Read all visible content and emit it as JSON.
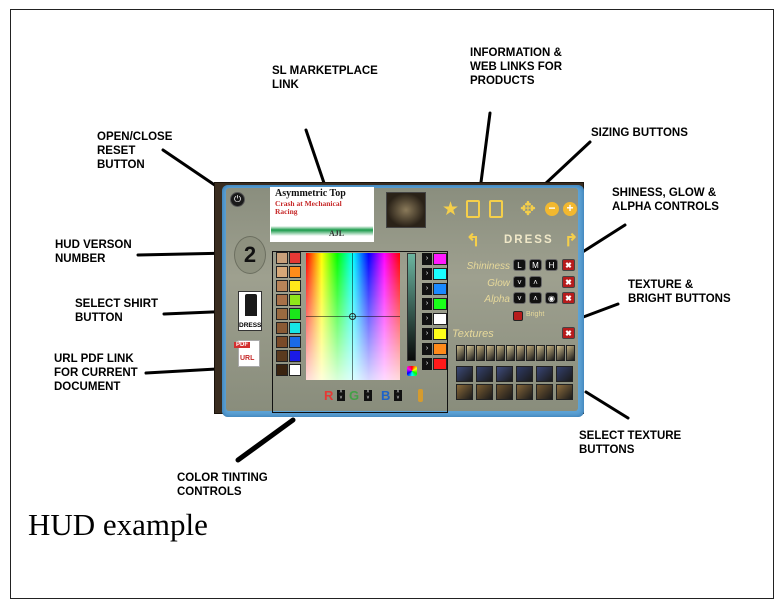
{
  "caption": "HUD example",
  "callouts": {
    "marketplace": "SL MARKETPLACE\nLINK",
    "info": "INFORMATION &\nWEB LINKS FOR\nPRODUCTS",
    "sizing": "SIZING BUTTONS",
    "open_close": "OPEN/CLOSE\nRESET\nBUTTON",
    "shininess": "SHINESS, GLOW &\nALPHA CONTROLS",
    "version": "HUD VERSON\nNUMBER",
    "texture_bright": "TEXTURE &\nBRIGHT BUTTONS",
    "shirt": "SELECT SHIRT\nBUTTON",
    "pdf": "URL PDF LINK\nFOR CURRENT\nDOCUMENT",
    "select_texture": "SELECT TEXTURE\nBUTTONS",
    "color": "COLOR TINTING\nCONTROLS"
  },
  "hud": {
    "power_glyph": "⏻",
    "version_number": "2",
    "banner": {
      "title": "Asymmetric Top",
      "subtitle": "Crash at Mechanical Racing",
      "brand": "AJL"
    },
    "shirt_label": "DRESS",
    "pdf_tag": "PDF",
    "pdf_url": "URL",
    "top_icons": {
      "star": "★",
      "move": "✥",
      "minus": "−",
      "plus": "+"
    },
    "nav": {
      "title": "DRESS",
      "prev_arrow": "↰",
      "next_arrow": "↱"
    },
    "controls": {
      "shininess_label": "Shininess",
      "glow_label": "Glow",
      "alpha_label": "Alpha",
      "textures_label": "Textures",
      "bright_label": "Bright",
      "shine_l": "L",
      "shine_m": "M",
      "shine_h": "H",
      "down": "˅",
      "up": "˄",
      "eye": "◉",
      "x": "✖"
    },
    "color": {
      "r_label": "R",
      "g_label": "G",
      "b_label": "B",
      "arrow": "›",
      "swatch_colors": [
        "#c8a07a",
        "#e53935",
        "#d6a878",
        "#ff8c1a",
        "#b98458",
        "#ffe81a",
        "#a87048",
        "#8fe61a",
        "#9a6a40",
        "#1ae61a",
        "#8a5a34",
        "#16e6e6",
        "#7a4a28",
        "#1a6ae6",
        "#5a3a1e",
        "#1a1ae6",
        "#3a2410",
        "#ffffff"
      ],
      "chip_colors": [
        "#ff1aff",
        "#1affff",
        "#1a8aff",
        "#1aff1a",
        "#ffffff",
        "#ffff1a",
        "#ff8a1a",
        "#ff1a1a"
      ],
      "colors": {
        "r": "#e53935",
        "g": "#43a047",
        "b": "#1e63c8"
      }
    },
    "texture_colors_top": [
      "#c9b98a",
      "#d6c796",
      "#c4b07e",
      "#d1bd8c",
      "#c7b585",
      "#d3c494",
      "#cdb888",
      "#c2ad7c",
      "#d0bf8f",
      "#c8b483",
      "#d4c392",
      "#c6b282"
    ],
    "texture_colors_mid": [
      "#3c4a78",
      "#35426e",
      "#3f4d7e",
      "#2f3b66",
      "#394676",
      "#33406c"
    ],
    "texture_colors_bot": [
      "#8a6a3a",
      "#7a5d32",
      "#6f5530",
      "#84663a",
      "#755a33",
      "#8e6e3e"
    ]
  }
}
